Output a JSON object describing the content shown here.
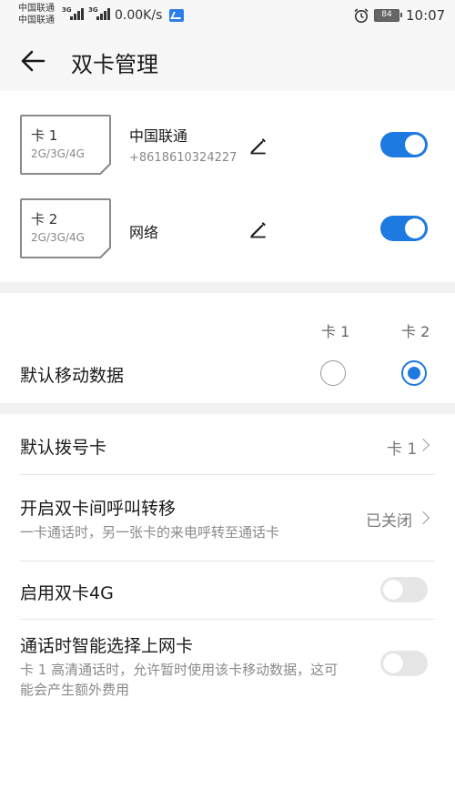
{
  "status_bar": {
    "carrier1": "中国联通",
    "carrier2": "中国联通",
    "net1": "3G",
    "net2": "3G",
    "speed": "0.00K/s",
    "battery": "84",
    "time": "10:07"
  },
  "header": {
    "title": "双卡管理"
  },
  "sims": [
    {
      "name": "卡 1",
      "type": "2G/3G/4G",
      "carrier": "中国联通",
      "number": "+8618610324227",
      "enabled": true
    },
    {
      "name": "卡 2",
      "type": "2G/3G/4G",
      "carrier": "网络",
      "number": "",
      "enabled": true
    }
  ],
  "default_data": {
    "col1": "卡 1",
    "col2": "卡 2",
    "label": "默认移动数据",
    "selected": "卡 2"
  },
  "default_dial": {
    "label": "默认拨号卡",
    "value": "卡 1"
  },
  "call_forward": {
    "label": "开启双卡间呼叫转移",
    "sub": "一卡通话时，另一张卡的来电呼转至通话卡",
    "value": "已关闭"
  },
  "dual_4g": {
    "label": "启用双卡4G",
    "enabled": false
  },
  "smart_select": {
    "label": "通话时智能选择上网卡",
    "sub": "卡 1 高清通话时，允许暂时使用该卡移动数据，这可能会产生额外费用",
    "enabled": false
  },
  "colors": {
    "accent": "#1d7ae0",
    "band": "#f2f2f2"
  }
}
